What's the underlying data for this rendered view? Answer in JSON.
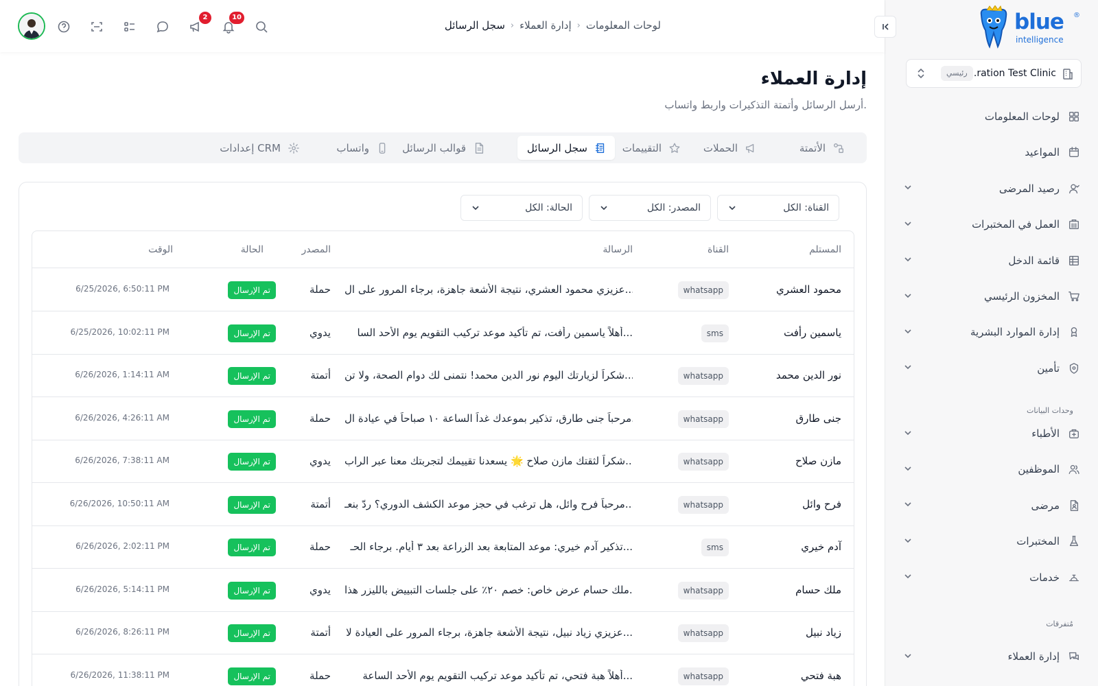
{
  "brand": {
    "word": "blue",
    "sub": "intelligence",
    "reg": "®",
    "accent": "#1e6fd9"
  },
  "clinic": {
    "name": "...ration Test Clinic",
    "tag": "رئيسي"
  },
  "sidebar": {
    "items": [
      {
        "label": "لوحات المعلومات",
        "icon": "grid-icon",
        "chevron": false
      },
      {
        "label": "المواعيد",
        "icon": "calendar-icon",
        "chevron": false
      },
      {
        "label": "رصيد المرضى",
        "icon": "user-icon",
        "chevron": true
      },
      {
        "label": "العمل في المختبرات",
        "icon": "lab-building-icon",
        "chevron": true
      },
      {
        "label": "قائمة الدخل",
        "icon": "table-icon",
        "chevron": true
      },
      {
        "label": "المخزون الرئيسي",
        "icon": "cart-icon",
        "chevron": true
      },
      {
        "label": "إدارة الموارد البشرية",
        "icon": "badge-icon",
        "chevron": true
      },
      {
        "label": "تأمين",
        "icon": "shield-icon",
        "chevron": true
      }
    ],
    "section_data": "وحدات البيانات",
    "data_items": [
      {
        "label": "الأطباء",
        "icon": "medical-bag-icon"
      },
      {
        "label": "الموظفين",
        "icon": "users-icon"
      },
      {
        "label": "مرضى",
        "icon": "file-user-icon"
      },
      {
        "label": "المختبرات",
        "icon": "flask-icon"
      },
      {
        "label": "خدمات",
        "icon": "service-icon"
      }
    ],
    "section_misc": "مُتفرقات",
    "misc_items": [
      {
        "label": "إدارة العملاء",
        "icon": "chat-icon"
      }
    ]
  },
  "breadcrumb": [
    "لوحات المعلومات",
    "إدارة العملاء",
    "سجل الرسائل"
  ],
  "topbar": {
    "notifications_badge": "10",
    "announcements_badge": "2"
  },
  "page": {
    "title": "إدارة العملاء",
    "subtitle": "أرسل الرسائل وأتمتة التذكيرات واربط واتساب."
  },
  "tabs": [
    {
      "label": "الأتمتة",
      "icon": "automation-icon"
    },
    {
      "label": "الحملات",
      "icon": "megaphone-icon"
    },
    {
      "label": "التقييمات",
      "icon": "star-icon"
    },
    {
      "label": "سجل الرسائل",
      "icon": "log-icon",
      "active": true
    },
    {
      "label": "قوالب الرسائل",
      "icon": "template-icon"
    },
    {
      "label": "واتساب",
      "icon": "phone-icon"
    },
    {
      "label": "إعدادات CRM",
      "icon": "gear-icon"
    }
  ],
  "filters": {
    "channel": "القناة: الكل",
    "source": "المصدر: الكل",
    "status": "الحالة: الكل"
  },
  "table": {
    "headers": {
      "recipient": "المستلم",
      "channel": "القناة",
      "message": "الرسالة",
      "source": "المصدر",
      "status": "الحالة",
      "time": "الوقت"
    },
    "rows": [
      {
        "recipient": "محمود العشري",
        "channel": "whatsapp",
        "message": "عزيزي محمود العشري، نتيجة الأشعة جاهزة، برجاء المرور على ال...",
        "source": "حملة",
        "status": "تم الإرسال",
        "time": "6/25/2026, 6:50:11 PM"
      },
      {
        "recipient": "ياسمين رأفت",
        "channel": "sms",
        "message": "أهلاً ياسمين رأفت، تم تأكيد موعد تركيب التقويم يوم الأحد السا...",
        "source": "يدوي",
        "status": "تم الإرسال",
        "time": "6/25/2026, 10:02:11 PM"
      },
      {
        "recipient": "نور الدين محمد",
        "channel": "whatsapp",
        "message": "شكراً لزيارتك اليوم نور الدين محمد! نتمنى لك دوام الصحة، ولا تن...",
        "source": "أتمتة",
        "status": "تم الإرسال",
        "time": "6/26/2026, 1:14:11 AM"
      },
      {
        "recipient": "جنى طارق",
        "channel": "whatsapp",
        "message": "مرحباً جنى طارق، تذكير بموعدك غداً الساعة ١٠ صباحاً في عيادة ال...",
        "source": "حملة",
        "status": "تم الإرسال",
        "time": "6/26/2026, 4:26:11 AM"
      },
      {
        "recipient": "مازن صلاح",
        "channel": "whatsapp",
        "message": "شكراً لثقتك مازن صلاح 🌟 يسعدنا تقييمك لتجربتك معنا عبر الراب...",
        "source": "يدوي",
        "status": "تم الإرسال",
        "time": "6/26/2026, 7:38:11 AM"
      },
      {
        "recipient": "فرح وائل",
        "channel": "whatsapp",
        "message": "مرحباً فرح وائل، هل ترغب في حجز موعد الكشف الدوري؟ ردّ بنعـ...",
        "source": "أتمتة",
        "status": "تم الإرسال",
        "time": "6/26/2026, 10:50:11 AM"
      },
      {
        "recipient": "آدم خيري",
        "channel": "sms",
        "message": "تذكير آدم خيري: موعد المتابعة بعد الزراعة بعد ٣ أيام. برجاء الحـ...",
        "source": "حملة",
        "status": "تم الإرسال",
        "time": "6/26/2026, 2:02:11 PM"
      },
      {
        "recipient": "ملك حسام",
        "channel": "whatsapp",
        "message": "ملك حسام عرض خاص: خصم ٢٠٪ على جلسات التبييض بالليزر هذا...",
        "source": "يدوي",
        "status": "تم الإرسال",
        "time": "6/26/2026, 5:14:11 PM"
      },
      {
        "recipient": "زياد نبيل",
        "channel": "whatsapp",
        "message": "عزيزي زياد نبيل، نتيجة الأشعة جاهزة، برجاء المرور على العيادة لا...",
        "source": "أتمتة",
        "status": "تم الإرسال",
        "time": "6/26/2026, 8:26:11 PM"
      },
      {
        "recipient": "هبة فتحي",
        "channel": "whatsapp",
        "message": "أهلاً هبة فتحي، تم تأكيد موعد تركيب التقويم يوم الأحد الساعة...",
        "source": "حملة",
        "status": "تم الإرسال",
        "time": "6/26/2026, 11:38:11 PM"
      }
    ]
  },
  "colors": {
    "status_sent": "#16c15c",
    "badge": "#e11d2e",
    "avatar_ring": "#1db954"
  }
}
